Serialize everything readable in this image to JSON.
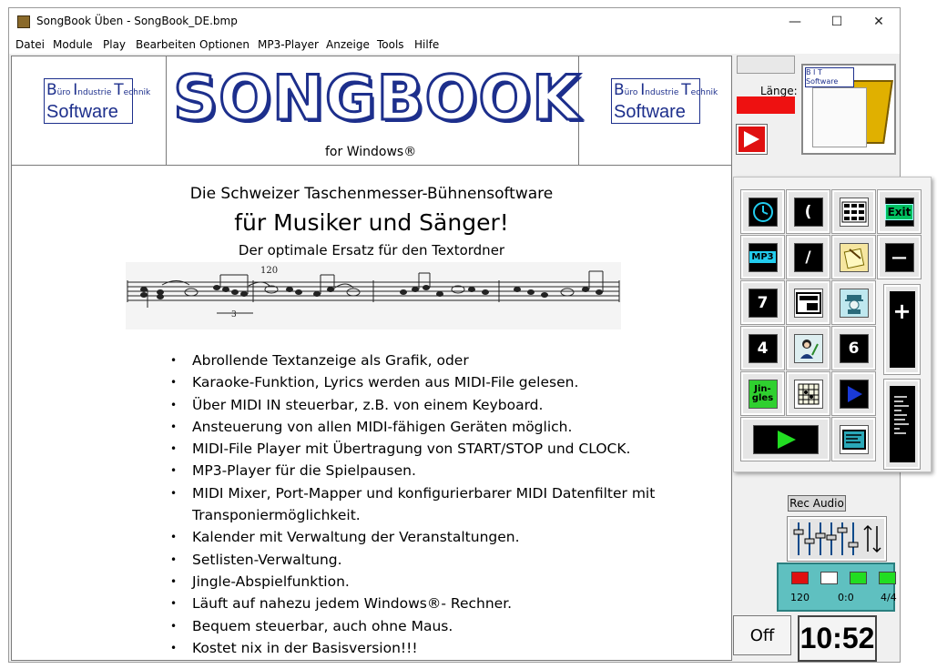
{
  "window": {
    "title": "SongBook Üben - SongBook_DE.bmp",
    "minimize_glyph": "—",
    "maximize_glyph": "☐",
    "close_glyph": "✕"
  },
  "menu": [
    "Datei",
    "Module",
    "Play",
    "Bearbeiten",
    "Optionen",
    "MP3-Player",
    "Anzeige",
    "Tools",
    "Hilfe"
  ],
  "banner": {
    "left_logo": {
      "line_b": "B",
      "line_b_word": "üro",
      "line_i": "I",
      "line_i_word": "ndustrie",
      "line_t": "T",
      "line_t_word": "echnik",
      "software": "Software"
    },
    "right_logo": {
      "line_b": "B",
      "line_b_word": "üro",
      "line_i": "I",
      "line_i_word": "ndustrie",
      "line_t": "T",
      "line_t_word": "echnik",
      "software": "Software"
    },
    "title": "SONGBOOK",
    "subtitle": "for Windows®"
  },
  "content": {
    "line1": "Die Schweizer Taschenmesser-Bühnensoftware",
    "line2": "für Musiker  und Sänger!",
    "line3": "Der optimale Ersatz für den Textordner",
    "score_tempo": "120",
    "score_triplet": "3",
    "features": [
      "Abrollende Textanzeige als Grafik, oder",
      "Karaoke-Funktion, Lyrics werden aus MIDI-File gelesen.",
      "Über MIDI IN steuerbar, z.B. von einem Keyboard.",
      "Ansteuerung von allen MIDI-fähigen Geräten möglich.",
      "MIDI-File Player mit Übertragung von START/STOP und CLOCK.",
      "MP3-Player für die Spielpausen.",
      "MIDI Mixer, Port-Mapper und konfigurierbarer MIDI Datenfilter mit Transponiermöglichkeit.",
      "Kalender mit Verwaltung der Veranstaltungen.",
      "Setlisten-Verwaltung.",
      "Jingle-Abspielfunktion.",
      "Läuft auf nahezu jedem Windows®- Rechner.",
      "Bequem steuerbar, auch ohne Maus.",
      "Kostet nix in der Basisversion!!!"
    ]
  },
  "side": {
    "length_label": "Länge:",
    "book_caption_b": "B",
    "book_caption_i": "I",
    "book_caption_t": "T",
    "book_caption_software": "Software",
    "rec_audio": "Rec Audio",
    "off": "Off",
    "clock": "10:52",
    "status": {
      "tempo": "120",
      "position": "0:0",
      "meter": "4/4"
    }
  },
  "toolbar": {
    "paren": "(",
    "exit": "Exit",
    "mp3": "MP3",
    "slash": "/",
    "minus": "—",
    "seven": "7",
    "plus": "+",
    "four": "4",
    "six": "6",
    "jingles": "Jin-\ngles"
  },
  "colors": {
    "logo_blue": "#1d2f8c",
    "alert_red": "#ee1111",
    "lamp_red": "#e01010",
    "lamp_white": "#ffffff",
    "lamp_green": "#22dd22",
    "status_bg": "#5fc0c0",
    "exit_green": "#00c060",
    "cyan_icon": "#22ccee"
  }
}
